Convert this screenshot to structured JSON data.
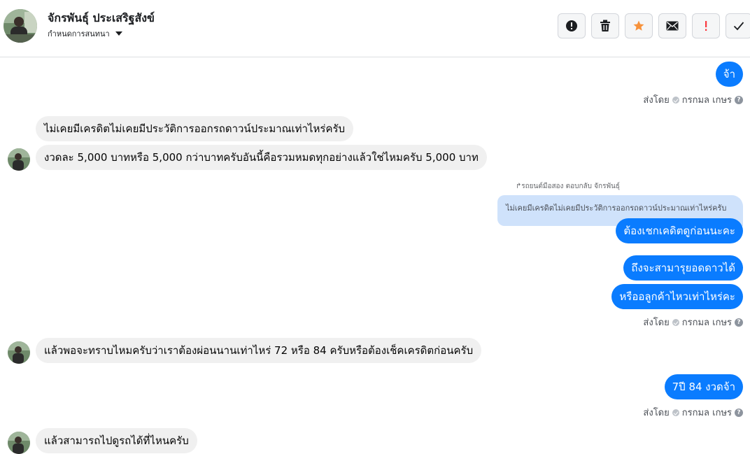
{
  "header": {
    "contact_name": "จักรพันธุ์ ประเสริฐสังข์",
    "assign_label": "กำหนดการสนทนา",
    "toolbar": [
      {
        "name": "alert-button",
        "icon": "alert-circle-icon"
      },
      {
        "name": "delete-button",
        "icon": "trash-icon"
      },
      {
        "name": "star-button",
        "icon": "star-icon",
        "color": "#f7923b"
      },
      {
        "name": "mark-unread-button",
        "icon": "envelope-icon"
      },
      {
        "name": "spam-button",
        "icon": "exclamation-icon",
        "color": "#fa383e"
      },
      {
        "name": "done-button",
        "icon": "check-icon"
      }
    ]
  },
  "messages": {
    "out_1": "จ้า",
    "sent_by_label": "ส่งโดย",
    "sent_by_name": "กรกมล เกษร",
    "in_1": "ไม่เคยมีเครดิตไม่เคยมีประวัติการออกรถดาวน์ประมาณเท่าไหร่ครับ",
    "in_2": "งวดละ 5,000 บาทหรือ 5,000 กว่าบาทครับอันนี้คือรวมหมดทุกอย่างแล้วใช่ไหมครับ 5,000 บาท",
    "reply_meta": "รถยนต์มือสอง ตอบกลับ จักรพันธุ์",
    "quoted_text": "ไม่เคยมีเครดิตไม่เคยมีประวัติการออกรถดาวน์ประมาณเท่าไหร่ครับ",
    "out_2": "ต้องเชกเคดิตดูก่อนนะคะ",
    "out_3": "ถึงจะสามารุยอดดาวได้",
    "out_4": "หรืออลูกค้าไหวเท่าไหร่คะ",
    "in_3": "แล้วพอจะทราบไหมครับว่าเราต้องผ่อนนานเท่าไหร่ 72 หรือ 84 ครับหรือต้องเช็คเครดิตก่อนครับ",
    "out_5": "7ปี 84 งวดจ้า",
    "in_4": "แล้วสามารถไปดูรถได้ที่ไหนครับ"
  },
  "colors": {
    "outgoing_bubble": "#0a7cff",
    "incoming_bubble": "#f0f0f0",
    "quote_bubble": "#cfe2fb"
  }
}
